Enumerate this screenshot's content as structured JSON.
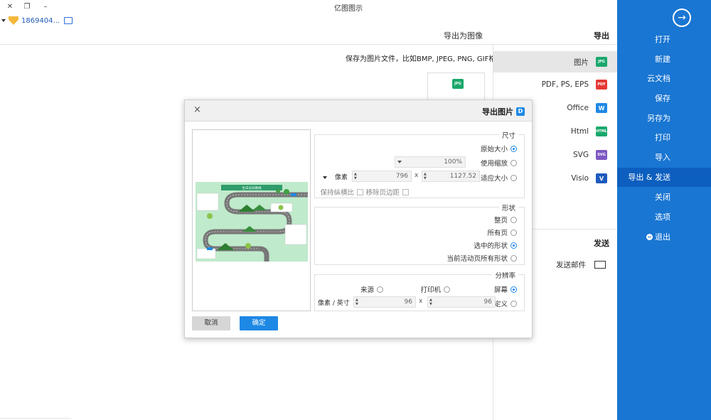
{
  "window": {
    "title": "亿图图示",
    "minimize": "–",
    "restore": "❐",
    "close": "✕"
  },
  "user": {
    "account": "1869404..."
  },
  "sidebar": {
    "back": "→",
    "items": [
      "打开",
      "新建",
      "云文档",
      "保存",
      "另存为",
      "打印",
      "导入",
      "导出 & 发送",
      "关闭",
      "选项",
      "退出"
    ]
  },
  "export": {
    "heading": "导出",
    "types": [
      {
        "label": "图片",
        "badge": "JPG",
        "color": "#1aa86b"
      },
      {
        "label": "PDF, PS, EPS",
        "badge": "PDF",
        "color": "#e53935"
      },
      {
        "label": "Office",
        "badge": "W",
        "color": "#1e88e5"
      },
      {
        "label": "Html",
        "badge": "HTML",
        "color": "#1aa86b"
      },
      {
        "label": "SVG",
        "badge": "SVG",
        "color": "#7e57c2"
      },
      {
        "label": "Visio",
        "badge": "V",
        "color": "#1e5bbd"
      }
    ],
    "send_heading": "发送",
    "send_mail": "发送邮件"
  },
  "main": {
    "title": "导出为图像",
    "description": "保存为图片文件，比如BMP, JPEG, PNG, GIF格式。",
    "card_badge": "JPG"
  },
  "dialog": {
    "title": "导出图片",
    "logo": "D",
    "close": "×",
    "size_group": "尺寸",
    "size_original": "原始大小",
    "size_zoom": "使用缩放",
    "zoom_value": "100%",
    "size_fit": "适应大小",
    "width_value": "1127.52",
    "height_value": "796",
    "unit_value": "像素",
    "remove_margin": "移除页边距",
    "keep_ratio": "保持纵横比",
    "shape_group": "形状",
    "shape_whole": "整页",
    "shape_all": "所有页",
    "shape_selected": "选中的形状",
    "shape_current_all": "当前活动页所有形状",
    "res_group": "分辨率",
    "res_screen": "屏幕",
    "res_printer": "打印机",
    "res_source": "来源",
    "res_custom": "自定义",
    "res_x": "96",
    "res_y": "96",
    "res_unit": "像素 / 英寸",
    "ok": "确定",
    "cancel": "取消",
    "preview_title": "生日派对路线"
  }
}
